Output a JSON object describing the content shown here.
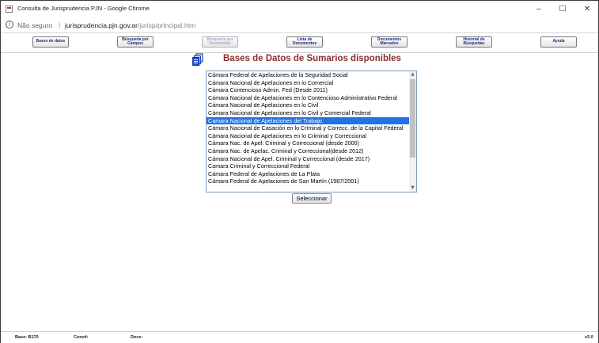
{
  "window": {
    "title": "Consulta de Jurisprudencia PJN - Google Chrome",
    "controls": {
      "minimize": "–",
      "maximize": "☐",
      "close": "✕"
    }
  },
  "addressbar": {
    "info_symbol": "i",
    "security_label": "Não seguro",
    "separator": "|",
    "url_host": "jurisprudencia.pjn.gov.ar",
    "url_path": "/jurisp/principal.htm"
  },
  "toolbar": {
    "buttons": [
      {
        "label": "Bases de datos",
        "enabled": true
      },
      {
        "label": "Búsqueda por Campos",
        "enabled": true
      },
      {
        "label": "Búsqueda por Proximidad",
        "enabled": false
      },
      {
        "label": "Lista de Documentos",
        "enabled": true
      },
      {
        "label": "Documentos Marcados",
        "enabled": true
      },
      {
        "label": "Historial de Búsquedas",
        "enabled": true
      },
      {
        "label": "Ayuda",
        "enabled": true
      }
    ]
  },
  "main": {
    "icon": "database-docs-icon",
    "heading": "Bases de Datos de Sumarios disponibles",
    "list": {
      "selected_index": 6,
      "items": [
        "Cámara Federal de Apelaciones de la Seguridad Social",
        "Cámara Nacional de Apelaciones en lo Comercial",
        "Cámara Contencioso Admin. Fed (Desde 2011)",
        "Cámara Nacional de Apelaciones en lo Contencioso Administrativo Federal",
        "Cámara Nacional de Apelaciones en lo Civil",
        "Cámara Nacional de Apelaciones en lo Civil y Comercial Federal",
        "Camara Nacional de Apelaciones del Trabajo.",
        "Cámara Nacional de Casación en lo Criminal y Correcc. de la Capital Federal",
        "Cámara Nacional de Apelaciones en lo Criminal y Correccional",
        "Cámara Nac. de Apel. Criminal y Correccional (desde 2000)",
        "Cámara Nac. de Apelac. Criminal y Correccional(desde 2012)",
        "Cámara Nacional de Apel. Criminal y Correccional (desde 2017)",
        "Camara Criminal y Correccional Federal",
        "Cámara Federal de Apelaciones de La Plata",
        "Cámara Federal de Apelaciones de San Martín (1987/2001)"
      ]
    },
    "select_button": "Seleccionar"
  },
  "statusbar": {
    "base": "Base: B170",
    "cons": "Cons#:",
    "docs": "Docs:",
    "version": "v3.0"
  },
  "colors": {
    "heading": "#8b2f2f",
    "toolbar_text": "#1a2a80",
    "selection": "#1e73e6"
  }
}
